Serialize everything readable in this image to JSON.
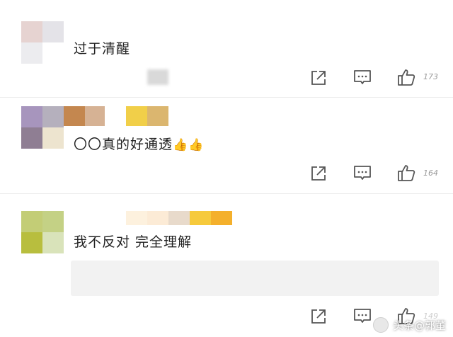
{
  "comments": [
    {
      "text": "过于清醒",
      "likes": "173"
    },
    {
      "text": "〇〇真的好通透",
      "emoji": "👍👍",
      "likes": "164"
    },
    {
      "text": "我不反对 完全理解",
      "likes": "149"
    }
  ],
  "watermark": {
    "text": "头条@郭董"
  }
}
